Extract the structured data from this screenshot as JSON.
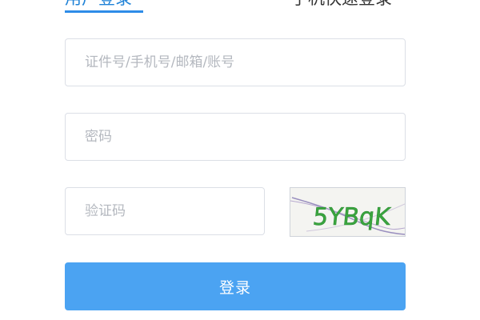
{
  "tabs": {
    "account_login": "用户登录",
    "phone_login": "手机快速登录"
  },
  "form": {
    "account_placeholder": "证件号/手机号/邮箱/账号",
    "account_value": "",
    "password_placeholder": "密码",
    "password_value": "",
    "captcha_placeholder": "验证码",
    "captcha_value": "",
    "captcha_image_text": "5YBqK",
    "login_label": "登录"
  },
  "colors": {
    "accent": "#1f82d7",
    "button": "#4ba3f2",
    "border": "#dcdfe6",
    "placeholder": "#b4b8bf",
    "captcha_text": "#3aa63f"
  }
}
